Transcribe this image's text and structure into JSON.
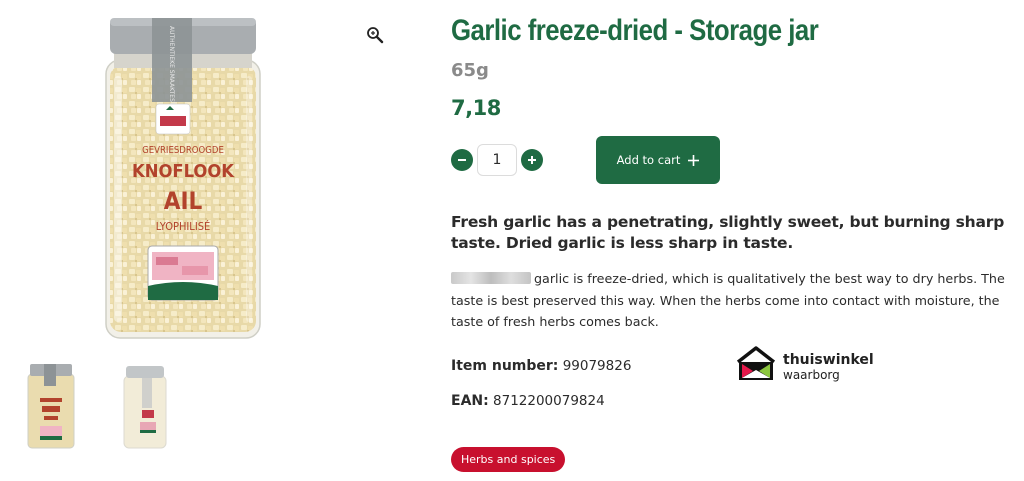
{
  "product": {
    "title": "Garlic freeze-dried - Storage jar",
    "weight": "65g",
    "price": "7,18",
    "quantity": "1",
    "add_to_cart_label": "Add to cart",
    "lead": "Fresh garlic has a penetrating, slightly sweet, but burning sharp taste. Dried garlic is less sharp in taste.",
    "description": "garlic is freeze-dried, which is qualitatively the best way to dry herbs. The taste is best preserved this way. When the herbs come into contact with moisture, the taste of fresh herbs comes back.",
    "item_number_label": "Item number:",
    "item_number": "99079826",
    "ean_label": "EAN:",
    "ean": "8712200079824",
    "category_tag": "Herbs and spices"
  },
  "jar_label": {
    "line1": "GEVRIESDROOGDE",
    "line2": "KNOFLOOK",
    "line3": "AIL",
    "line4": "LYOPHILISÉ",
    "band": "AUTHENTIEKE SMAAKTEST"
  },
  "trust_badge": {
    "line1": "thuiswinkel",
    "line2": "waarborg"
  },
  "icons": {
    "zoom": "magnifier-icon",
    "minus": "minus-icon",
    "plus": "plus-icon"
  },
  "colors": {
    "brand_green": "#1f6b43",
    "tag_red": "#c8102e",
    "weight_gray": "#8a8a8a"
  }
}
